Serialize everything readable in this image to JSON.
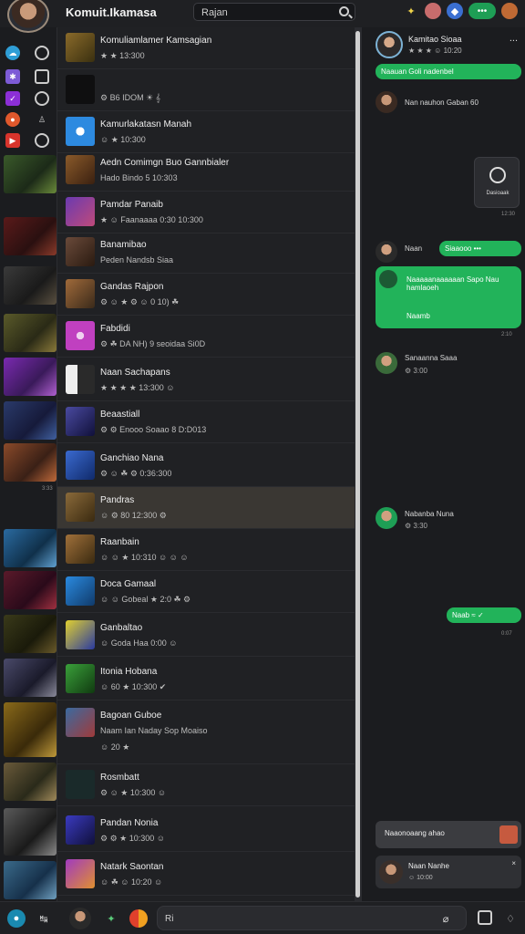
{
  "app": {
    "title": "Komuit.Ikamasa"
  },
  "search": {
    "value": "Rajan",
    "placeholder": ""
  },
  "header_icons": [
    "sparkle-icon",
    "profile-icon",
    "shield-icon",
    "status-icon",
    "user-avatar-icon"
  ],
  "header_status": "•••",
  "rail": {
    "icons": [
      "discord-icon",
      "compass-icon",
      "slack-icon",
      "lock-icon",
      "mail-icon",
      "clock-icon",
      "reddit-icon",
      "person-icon",
      "youtube-icon",
      "search-icon"
    ],
    "timestamp": "3:33"
  },
  "list": {
    "rows": [
      {
        "name": "Komuliamlamer Kamsagian",
        "meta": "★ ★ 13:300"
      },
      {
        "name": "",
        "meta": "⚙ B6 IDOM ☀ 𝄞"
      },
      {
        "name": "Kamurlakatasn Manah",
        "meta": "☺ ★ 10:300"
      },
      {
        "name": "Aedn Comimgn Buo Gannbialer",
        "meta": "Hado Bindo 5 10:303"
      },
      {
        "name": "Pamdar Panaib",
        "meta": "★ ☺ Faanaaaa 0:30 10:300"
      },
      {
        "name": "Banamibao",
        "meta": "Peden Nandsb Siaa"
      },
      {
        "name": "Gandas Rajpon",
        "meta": "⚙ ☺ ★ ⚙ ☺ 0 10) ☘"
      },
      {
        "name": "Fabdidi",
        "meta": "⚙ ☘ DA NH) 9 seoidaa Si0D"
      },
      {
        "name": "Naan Sachapans",
        "meta": "★ ★ ★ ★ 13:300 ☺"
      },
      {
        "name": "Beaastiall",
        "meta": "⚙ ⚙ Enooo Soaao 8 D:D013"
      },
      {
        "name": "Ganchiao Nana",
        "meta": "⚙ ☺ ☘ ⚙ 0:36:300"
      },
      {
        "name": "Pandras",
        "meta": "☺ ⚙ 80 12:300 ⚙"
      },
      {
        "name": "Raanbain",
        "meta": "☺ ☺ ★ 10:310 ☺ ☺ ☺"
      },
      {
        "name": "Doca Gamaal",
        "meta": "☺ ☺ Gobeal ★ 2:0 ☘ ⚙"
      },
      {
        "name": "Ganbaltao",
        "meta": "☺ Goda Haa 0:00 ☺"
      },
      {
        "name": "Itonia Hobana",
        "meta": "☺ 60 ★ 10:300 ✔"
      },
      {
        "name": "Bagoan Guboe",
        "meta": "Naam Ian Naday Sop Moaiso"
      },
      {
        "name": "Rosmbatt",
        "meta": "⚙ ☺ ★ 10:300 ☺"
      },
      {
        "name": "Pandan Nonia",
        "meta": "⚙ ⚙ ★ 10:300 ☺"
      },
      {
        "name": "Natark Saontan",
        "meta": "☺ ☘ ☺ 10:20 ☺"
      }
    ],
    "extra_meta": "Naam Ian Naday Sop Moaiso",
    "extra_meta2": "☺ 20 ★"
  },
  "chat": {
    "header": {
      "name": "Kamitao Sioaa",
      "meta": "★ ★ ★ ☺ 10:20",
      "more": "..."
    },
    "messages": [
      {
        "type": "out",
        "text": "Naauan Goli nadenbel"
      },
      {
        "type": "in",
        "text": "Nan nauhon Gaban 60"
      },
      {
        "type": "card",
        "text": "Dasioaak",
        "time": "12:30"
      },
      {
        "type": "in",
        "text": "Naan"
      },
      {
        "type": "out",
        "text": "Siaaooo •••"
      },
      {
        "type": "out",
        "text": "Naaaaanaaaaaan Sapo Nau hamlaoeh",
        "time": "Naamb"
      },
      {
        "type": "in",
        "text": "Sanaanna Saaa",
        "time": "⚙ 3:00"
      },
      {
        "type": "in",
        "text": "Nabanba Nuna",
        "time": "⚙ 3:30"
      },
      {
        "type": "out",
        "text": "Naab ≈ ✓"
      }
    ],
    "timestamps": [
      "2:10",
      "0:07",
      "3:00",
      "3:00"
    ],
    "mini1": {
      "text": "Naaonoaang ahao"
    },
    "mini2": {
      "name": "Naan Nanhe",
      "meta": "☺ 10:00",
      "close": "×"
    }
  },
  "bottom": {
    "compose_value": "Ri",
    "compose_placeholder": ""
  }
}
